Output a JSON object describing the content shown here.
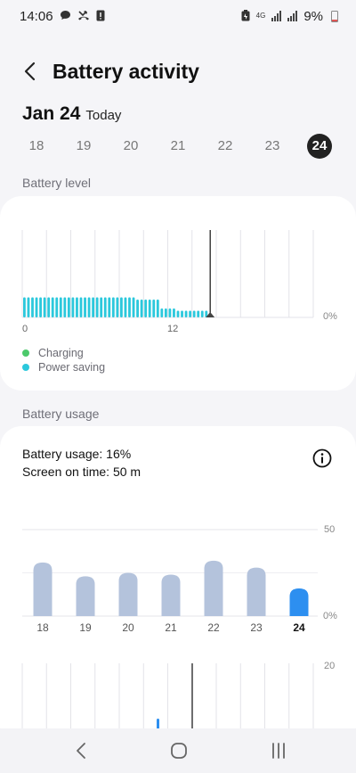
{
  "status_bar": {
    "time": "14:06",
    "network": "4G",
    "battery_percent": "9%",
    "icons": [
      "chat-bubble-icon",
      "missed-call-icon",
      "alert-icon",
      "battery-saver-icon",
      "signal-icon",
      "battery-icon"
    ]
  },
  "header": {
    "title": "Battery activity",
    "back_icon": "chevron-left-icon"
  },
  "date": {
    "main": "Jan 24",
    "sub": "Today"
  },
  "days": [
    {
      "label": "18",
      "selected": false
    },
    {
      "label": "19",
      "selected": false
    },
    {
      "label": "20",
      "selected": false
    },
    {
      "label": "21",
      "selected": false
    },
    {
      "label": "22",
      "selected": false
    },
    {
      "label": "23",
      "selected": false
    },
    {
      "label": "24",
      "selected": true
    }
  ],
  "battery_level": {
    "section_label": "Battery level",
    "y_label": "0%",
    "x_labels": [
      "0",
      "12"
    ],
    "legend": [
      {
        "label": "Charging",
        "color": "#4cc96b"
      },
      {
        "label": "Power saving",
        "color": "#2bc8dc"
      }
    ],
    "bar_color": "#2bc8dc",
    "current_hour": 15.5,
    "levels": [
      9,
      9,
      9,
      9,
      9,
      9,
      9,
      9,
      9,
      9,
      9,
      9,
      9,
      9,
      9,
      9,
      9,
      9,
      9,
      9,
      9,
      9,
      9,
      9,
      9,
      9,
      9,
      9,
      8,
      8,
      8,
      8,
      8,
      8,
      4,
      4,
      4,
      4,
      3,
      3,
      3,
      3,
      3,
      3,
      3,
      3
    ]
  },
  "battery_usage": {
    "section_label": "Battery usage",
    "usage_text": "Battery usage: 16%",
    "screen_time_text": "Screen on time: 50 m",
    "info_icon": "info-icon",
    "chart_data": {
      "type": "bar",
      "categories": [
        "18",
        "19",
        "20",
        "21",
        "22",
        "23",
        "24"
      ],
      "values": [
        31,
        23,
        25,
        24,
        32,
        28,
        16
      ],
      "highlight_index": 6,
      "ylim": [
        0,
        50
      ],
      "y_tick_labels": [
        "50",
        "0%"
      ],
      "bar_color": "#b4c3dc",
      "highlight_color": "#2d8ff0"
    },
    "hourly": {
      "y_label": "20",
      "bar_color": "#2d8ff0"
    }
  },
  "nav_bar": {
    "recents_icon": "recents-icon",
    "home_icon": "home-icon",
    "back_icon": "back-icon"
  }
}
